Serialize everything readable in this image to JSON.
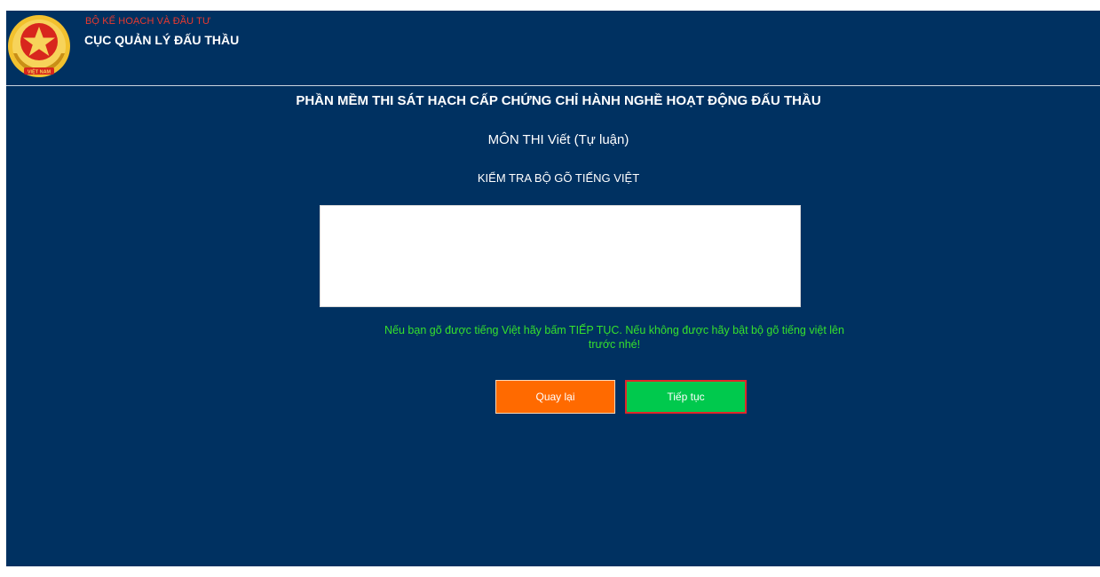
{
  "header": {
    "org_parent": "BỘ KẾ HOẠCH VÀ ĐẦU TƯ",
    "org_name": "CỤC QUẢN LÝ ĐẤU THẦU",
    "emblem_icon": "vietnam-national-emblem-icon",
    "emblem_text": "VIỆT NAM"
  },
  "main": {
    "app_title": "PHẦN MỀM THI SÁT HẠCH CẤP CHỨNG CHỈ HÀNH NGHỀ HOẠT ĐỘNG ĐẤU THẦU",
    "exam_subject": "MÔN THI Viết (Tự luận)",
    "check_title": "KIỂM TRA BỘ GÕ TIẾNG VIỆT",
    "typing_area_value": "",
    "instruction": "Nếu bạn gõ được tiếng Việt hãy bấm TIẾP TỤC. Nếu không được hãy bật bộ gõ tiếng việt lên trước nhé!"
  },
  "buttons": {
    "back_label": "Quay lại",
    "next_label": "Tiếp tục"
  },
  "colors": {
    "background": "#003161",
    "org_parent_text": "#e8392e",
    "instruction_text": "#35e02c",
    "back_button": "#ff6a00",
    "next_button": "#00c94d",
    "next_button_border": "#e0282a"
  }
}
